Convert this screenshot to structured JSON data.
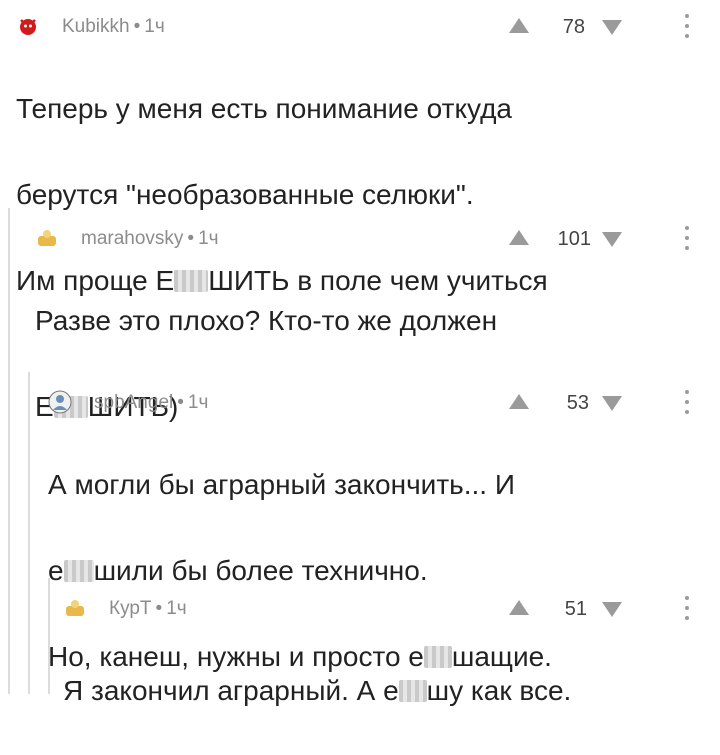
{
  "comments": [
    {
      "user": "Kubikkh",
      "time": "1ч",
      "votes": "78",
      "avatar": "red-devil-avatar",
      "avatar_color": "#d21a1a",
      "lines": [
        "Теперь у меня есть понимание откуда",
        "берутся \"необразованные селюки\".",
        "Им проще Е",
        "ШИТЬ в поле чем учиться"
      ]
    },
    {
      "user": "marahovsky",
      "time": "1ч",
      "votes": "101",
      "avatar": "default-avatar",
      "avatar_color": "#e8b84a",
      "lines": [
        "Разве это плохо? Кто-то же должен",
        "Е",
        "ШИТЬ)"
      ]
    },
    {
      "user": "spbAngel",
      "time": "1ч",
      "votes": "53",
      "avatar": "user-photo-avatar",
      "avatar_color": "#6a8fb5",
      "lines": [
        "А могли бы аграрный закончить... И",
        "е",
        "шили бы более технично.",
        "Но, канеш, нужны и просто е",
        "шащие."
      ]
    },
    {
      "user": "КурТ",
      "time": "1ч",
      "votes": "51",
      "avatar": "default-avatar",
      "avatar_color": "#e8b84a",
      "lines": [
        "Я закончил аграрный. А е",
        "шу как все."
      ]
    }
  ],
  "separator": "•"
}
